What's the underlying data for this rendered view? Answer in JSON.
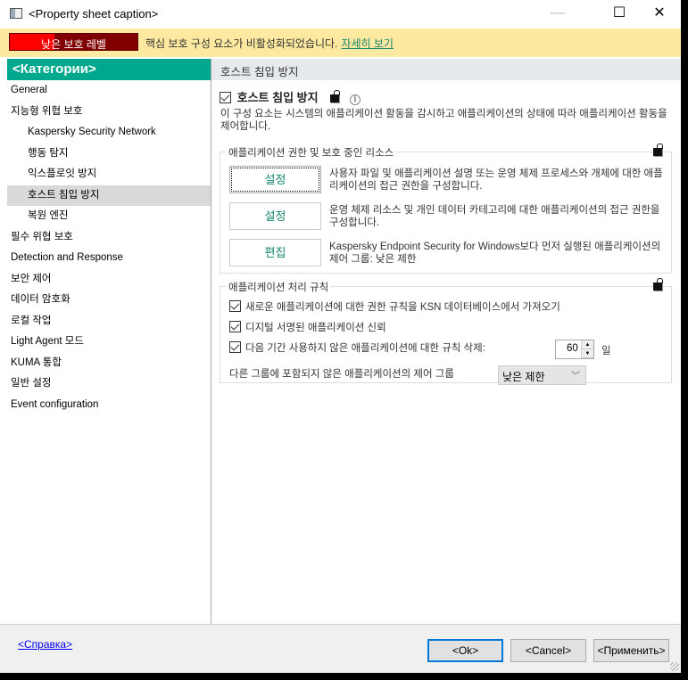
{
  "window": {
    "title": "<Property sheet caption>",
    "minimize": "—",
    "maximize": "☐",
    "close": "✕"
  },
  "banner": {
    "level_label": "낮은 보호 레벨",
    "level_fill_percent": 35,
    "message": "핵심 보호 구성 요소가 비활성화되었습니다.",
    "link": "자세히 보기"
  },
  "sidebar": {
    "header": "<Категории>",
    "items": [
      {
        "label": "General"
      },
      {
        "label": "지능형 위협 보호"
      },
      {
        "label": "Kaspersky Security Network"
      },
      {
        "label": "행동 탐지"
      },
      {
        "label": "익스플로잇 방지"
      },
      {
        "label": "호스트 침입 방지"
      },
      {
        "label": "복원 엔진"
      },
      {
        "label": "필수 위협 보호"
      },
      {
        "label": "Detection and Response"
      },
      {
        "label": "보안 제어"
      },
      {
        "label": "데이터 암호화"
      },
      {
        "label": "로컬 작업"
      },
      {
        "label": "Light Agent 모드"
      },
      {
        "label": "KUMA 통합"
      },
      {
        "label": "일반 설정"
      },
      {
        "label": "Event configuration"
      }
    ]
  },
  "main": {
    "header": "호스트 침입 방지",
    "enable_label": "호스트 침입 방지",
    "enable_checked": true,
    "description": "이 구성 요소는 시스템의 애플리케이션 활동을 감시하고 애플리케이션의 상태에 따라 애플리케이션 활동을 제어합니다.",
    "info_icon": "i",
    "group1": {
      "title": "애플리케이션 권한 및 보호 중인 리소스",
      "rows": [
        {
          "button": "설정",
          "desc": "사용자 파일 및 애플리케이션 설명 또는 운영 체제 프로세스와 개체에 대한 애플리케이션의 접근 권한을 구성합니다."
        },
        {
          "button": "설정",
          "desc": "운영 체제 리소스 및 개인 데이터 카테고리에 대한 애플리케이션의 접근 권한을 구성합니다."
        },
        {
          "button": "편집",
          "desc": "Kaspersky Endpoint Security for Windows보다 먼저 실행된 애플리케이션의 제어 그룹: 낮은 제한"
        }
      ]
    },
    "group2": {
      "title": "애플리케이션 처리 규칙",
      "opt1": "새로운 애플리케이션에 대한 권한 규칙을 KSN 데이터베이스에서 가져오기",
      "opt2": "디지털 서명된 애플리케이션 신뢰",
      "opt3": "다음 기간 사용하지 않은 애플리케이션에 대한 규칙 삭제:",
      "days_value": "60",
      "days_unit": "일",
      "up": "▲",
      "down": "▼",
      "group_label": "다른 그룹에 포함되지 않은 애플리케이션의 제어 그룹",
      "group_value": "낮은 제한",
      "chevron": "﹀"
    }
  },
  "footer": {
    "help": "<Справка>",
    "ok": "<Ok>",
    "cancel": "<Cancel>",
    "apply": "<Применить>"
  }
}
